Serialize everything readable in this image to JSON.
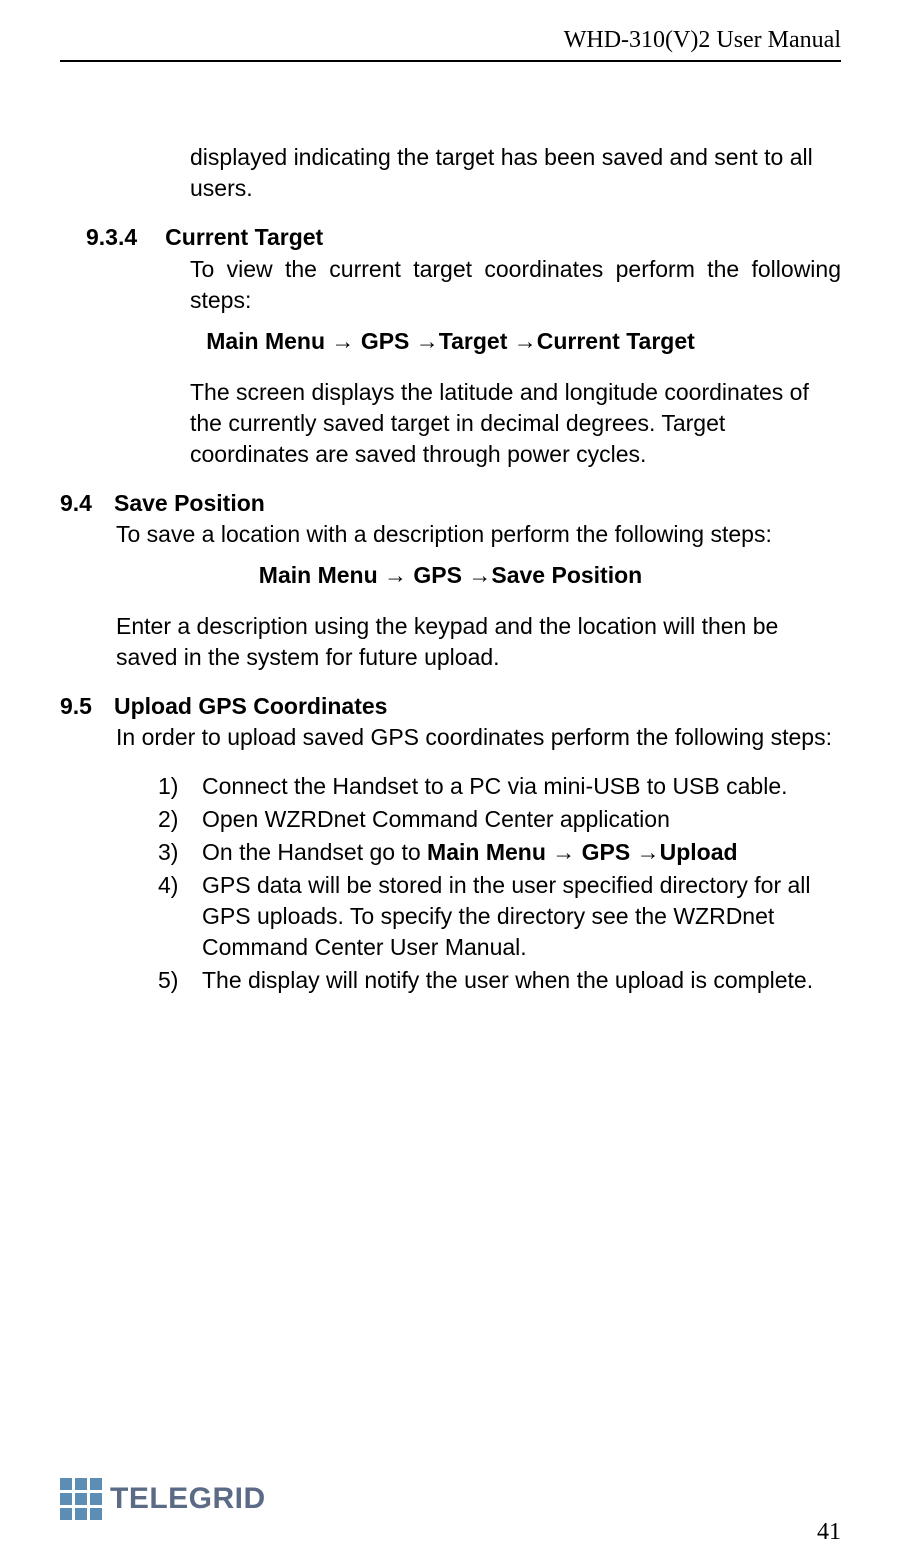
{
  "header": {
    "title": "WHD-310(V)2 User Manual"
  },
  "intro_continued": "displayed indicating the target has been saved and sent to all users.",
  "s934": {
    "num": "9.3.4",
    "title": "Current Target",
    "p1": "To view the current target coordinates perform the following steps:",
    "path": "Main Menu → GPS →Target →Current Target",
    "p2": "The screen displays the latitude and longitude coordinates of the currently saved target in decimal degrees.  Target coordinates are saved through power cycles."
  },
  "s94": {
    "num": "9.4",
    "title": "Save Position",
    "p1": "To save a location with a description perform the following steps:",
    "path": "Main Menu → GPS →Save Position",
    "p2": "Enter a description using the keypad and the location will then be saved in the system for future upload."
  },
  "s95": {
    "num": "9.5",
    "title": "Upload GPS Coordinates",
    "p1": "In order to upload saved GPS coordinates perform the following steps:",
    "list": [
      {
        "n": "1)",
        "text_before": "Connect the Handset to a PC via mini-USB to USB cable."
      },
      {
        "n": "2)",
        "text_before": "Open WZRDnet Command Center application"
      },
      {
        "n": "3)",
        "text_before": "On the Handset go to ",
        "bold": "Main Menu → GPS →Upload"
      },
      {
        "n": "4)",
        "text_before": "GPS data will be stored in the user specified directory for all GPS uploads.  To specify the directory see the WZRDnet Command Center User Manual."
      },
      {
        "n": "5)",
        "text_before": "The display will notify the user when the upload is complete."
      }
    ]
  },
  "footer": {
    "logo_text": "TELEGRID",
    "page_num": "41"
  }
}
